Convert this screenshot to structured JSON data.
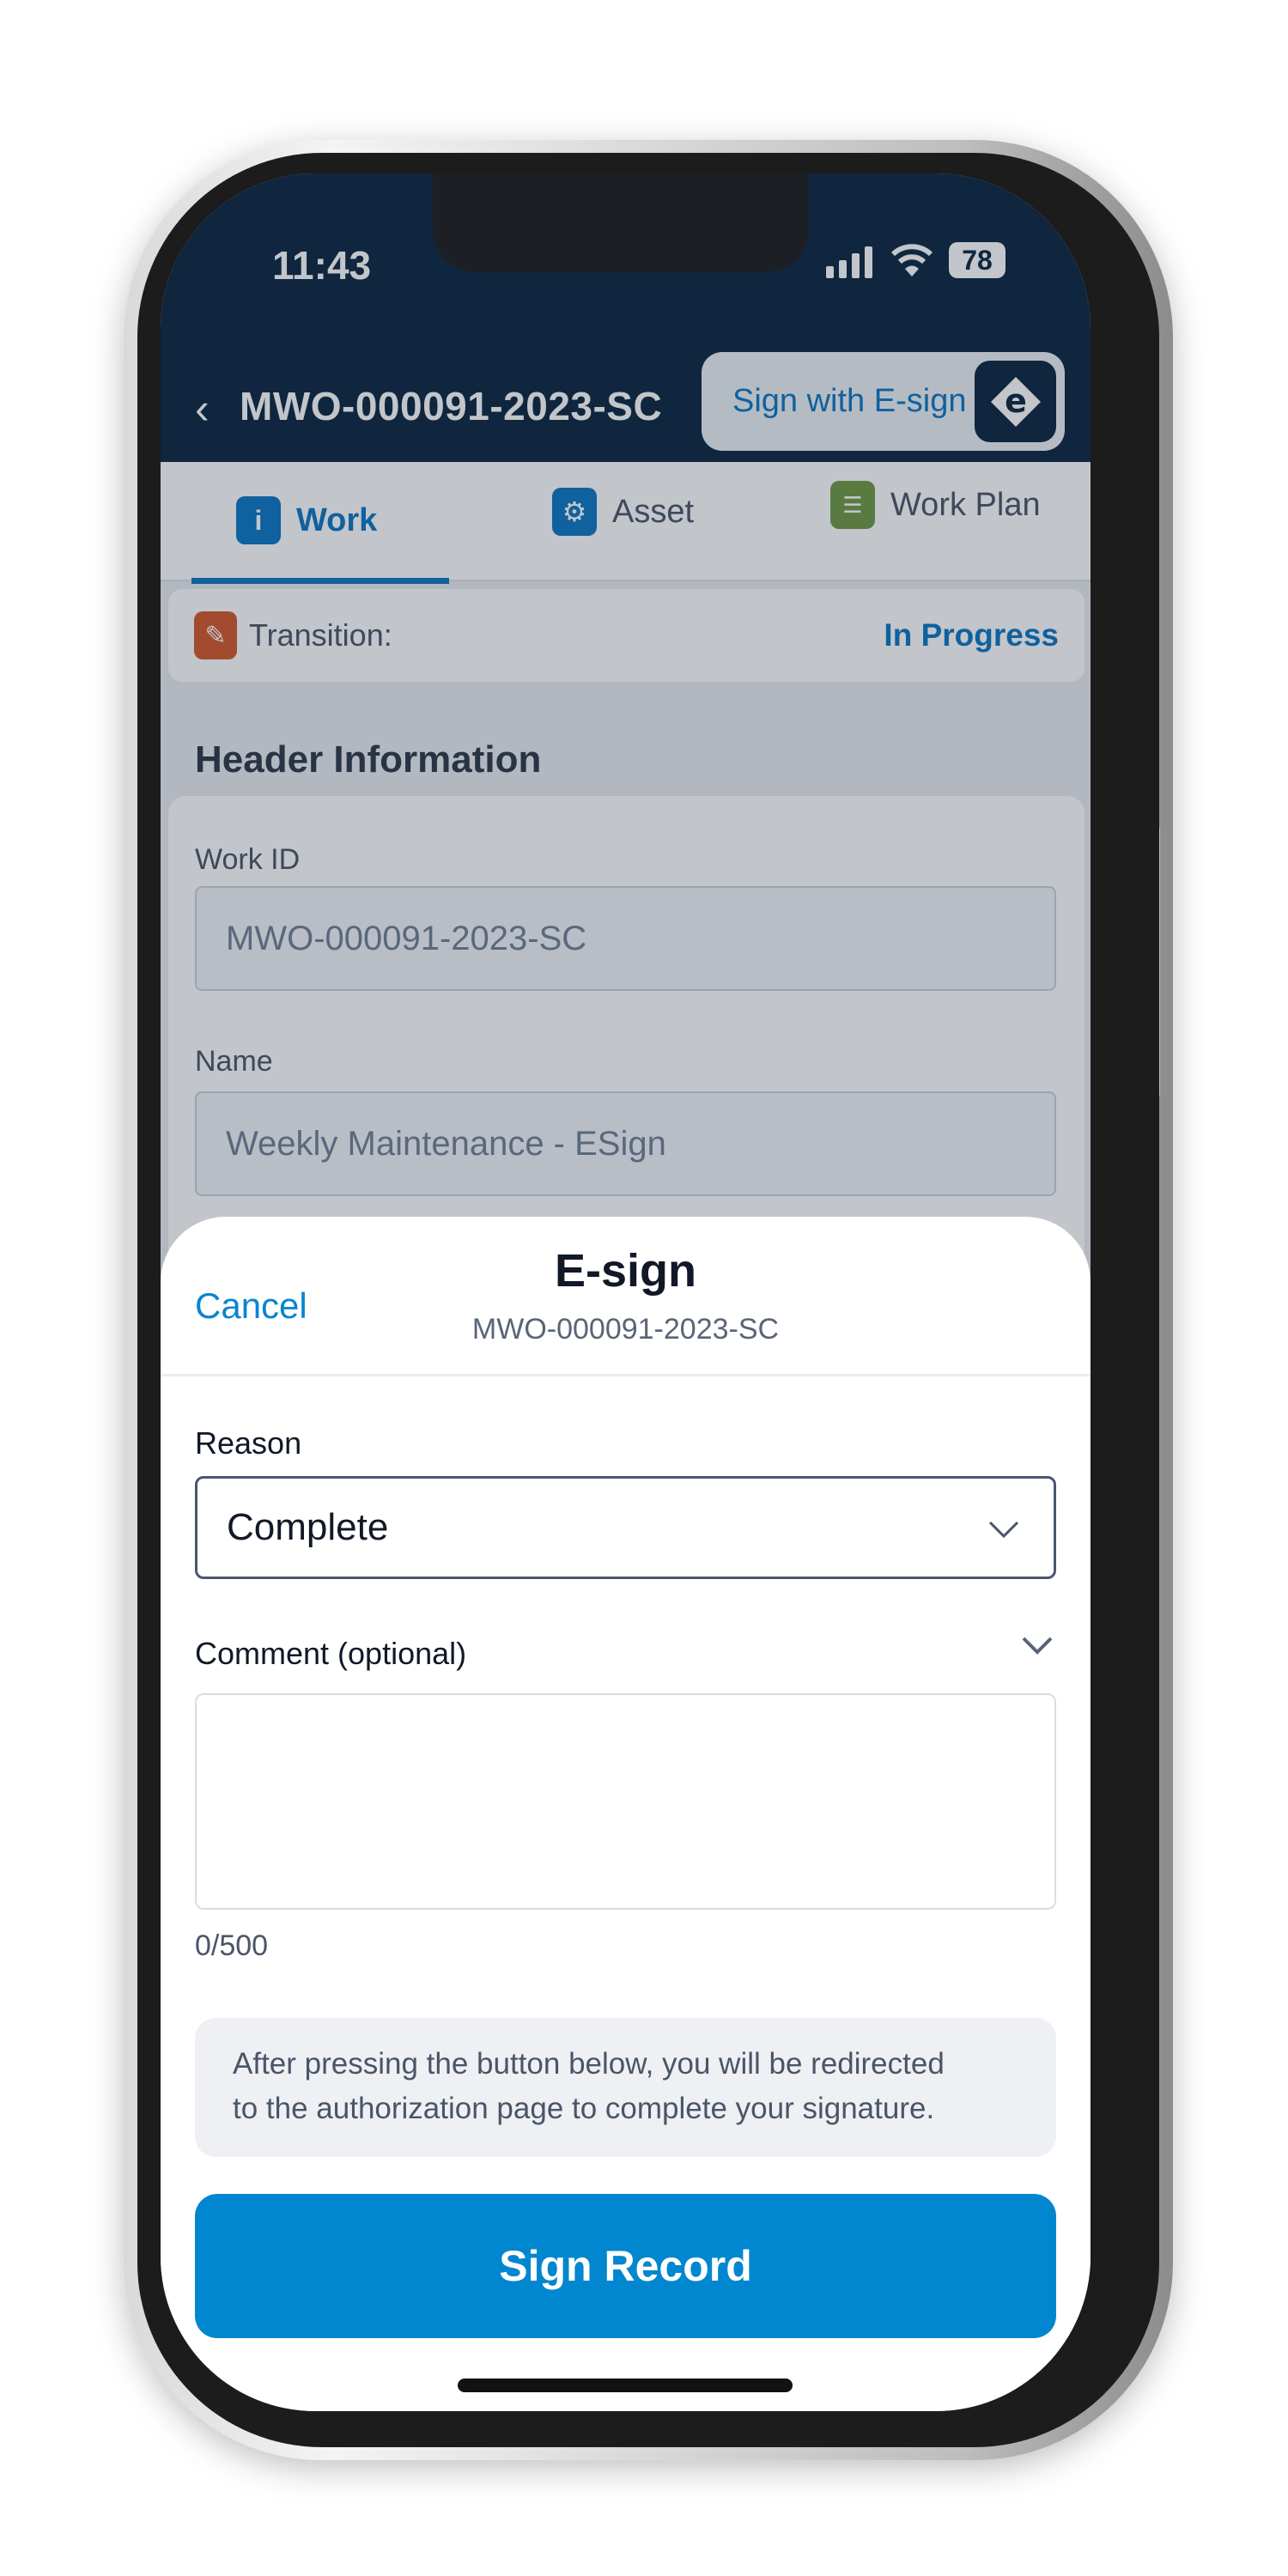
{
  "status_bar": {
    "time": "11:43",
    "battery": "78",
    "icons": [
      "signal-icon",
      "wifi-icon",
      "battery-icon"
    ]
  },
  "header": {
    "back_icon": "chevron-left-icon",
    "title": "MWO-000091-2023-SC",
    "esign_button": "Sign with E-sign",
    "esign_icon": "e"
  },
  "tabs": [
    {
      "label": "Work",
      "icon": "info-icon",
      "color": "#0a76c4",
      "active": true
    },
    {
      "label": "Asset",
      "icon": "gear-icon",
      "color": "#0a76c4",
      "active": false
    },
    {
      "label": "Work Plan",
      "icon": "list-icon",
      "color": "#6f9a45",
      "active": false
    }
  ],
  "transition": {
    "label": "Transition:",
    "value": "In Progress",
    "icon": "pencil-icon",
    "icon_color": "#d4582b"
  },
  "section": {
    "title": "Header Information",
    "fields": [
      {
        "label": "Work ID",
        "value": "MWO-000091-2023-SC"
      },
      {
        "label": "Name",
        "value": "Weekly Maintenance - ESign"
      }
    ]
  },
  "sheet": {
    "cancel": "Cancel",
    "title": "E-sign",
    "subtitle": "MWO-000091-2023-SC",
    "reason_label": "Reason",
    "reason_value": "Complete",
    "comment_label": "Comment (optional)",
    "comment_value": "",
    "comment_count": "0/500",
    "info_line1": "After pressing the button below, you will be redirected",
    "info_line2": "to the authorization page to complete your signature.",
    "sign_button": "Sign Record"
  },
  "colors": {
    "navy": "#0a2540",
    "accent": "#0087cf"
  }
}
